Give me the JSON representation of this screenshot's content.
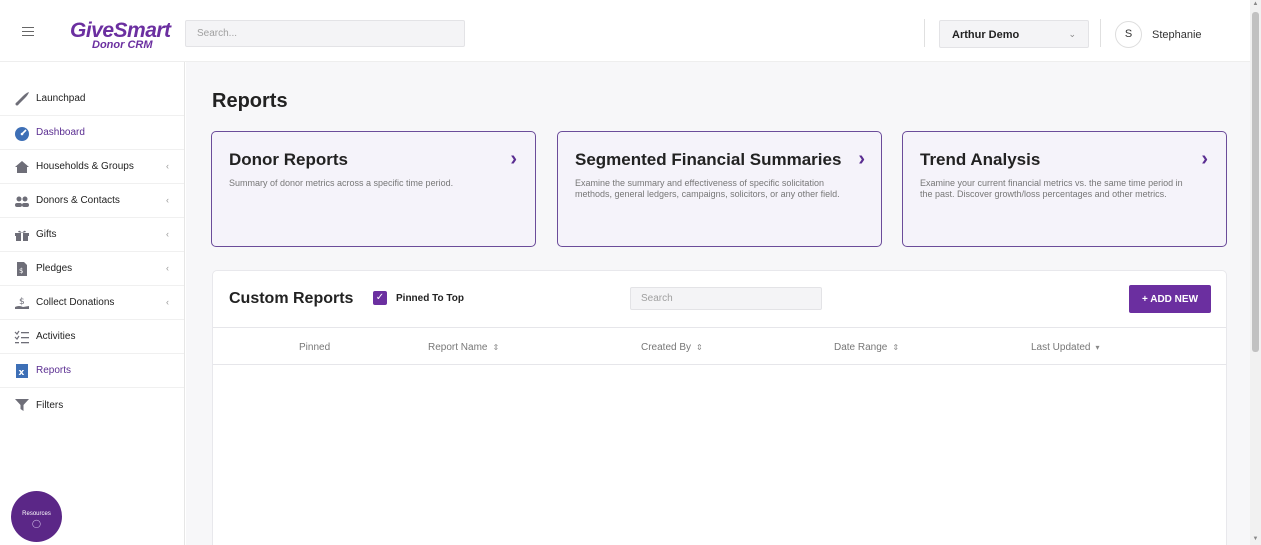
{
  "app": {
    "logo_brand": "GiveSmart",
    "logo_sub": "Donor CRM",
    "search_placeholder": "Search...",
    "org_name": "Arthur Demo",
    "user_initial": "S",
    "user_name": "Stephanie"
  },
  "sidebar": {
    "items": [
      {
        "label": "Launchpad",
        "icon": "rocket-icon"
      },
      {
        "label": "Dashboard",
        "icon": "gauge-icon"
      },
      {
        "label": "Households & Groups",
        "icon": "house-icon",
        "expandable": true
      },
      {
        "label": "Donors & Contacts",
        "icon": "people-icon",
        "expandable": true
      },
      {
        "label": "Gifts",
        "icon": "gift-icon",
        "expandable": true
      },
      {
        "label": "Pledges",
        "icon": "document-icon",
        "expandable": true
      },
      {
        "label": "Collect Donations",
        "icon": "donation-icon",
        "expandable": true
      },
      {
        "label": "Activities",
        "icon": "list-icon"
      },
      {
        "label": "Reports",
        "icon": "report-icon"
      },
      {
        "label": "Filters",
        "icon": "filter-icon"
      }
    ],
    "resources_label": "Resources"
  },
  "main": {
    "title": "Reports",
    "cards": [
      {
        "title": "Donor Reports",
        "description": "Summary of donor metrics across a specific time period."
      },
      {
        "title": "Segmented Financial Summaries",
        "description": "Examine the summary and effectiveness of specific solicitation methods, general ledgers, campaigns, solicitors, or any other field."
      },
      {
        "title": "Trend Analysis",
        "description": "Examine your current financial metrics vs. the same time period in the past. Discover growth/loss percentages and other metrics."
      }
    ],
    "custom_reports": {
      "title": "Custom Reports",
      "pinned_label": "Pinned To Top",
      "pinned_checked": true,
      "search_placeholder": "Search",
      "add_button": "+ ADD NEW",
      "columns": [
        "Pinned",
        "Report Name",
        "Created By",
        "Date Range",
        "Last Updated"
      ],
      "rows": []
    }
  },
  "colors": {
    "accent": "#6b2fa0",
    "card_border": "#6b4c9a",
    "resources_bg": "#5b2787"
  }
}
